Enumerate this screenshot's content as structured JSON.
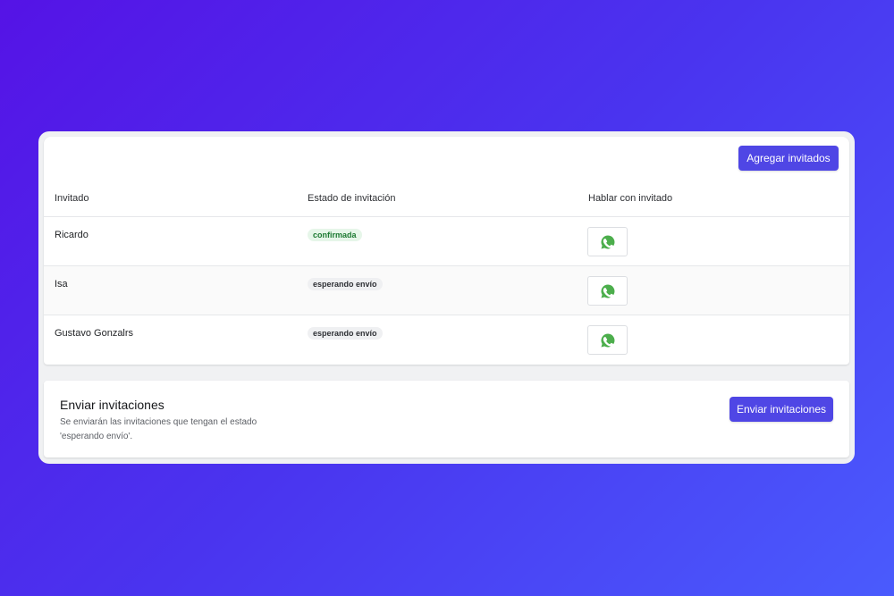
{
  "toolbar": {
    "add_guests_label": "Agregar invitados"
  },
  "table": {
    "columns": [
      "Invitado",
      "Estado de invitación",
      "Hablar con invitado"
    ],
    "rows": [
      {
        "name": "Ricardo",
        "status": "confirmada",
        "status_color": "#1d7a32",
        "action_icon": "whatsapp-icon"
      },
      {
        "name": "Isa",
        "status": "esperando envío",
        "status_color": "#2f3136",
        "action_icon": "whatsapp-icon"
      },
      {
        "name": "Gustavo Gonzalrs",
        "status": "esperando envío",
        "status_color": "#2f3136",
        "action_icon": "whatsapp-icon"
      }
    ]
  },
  "send_section": {
    "title": "Enviar invitaciones",
    "description": "Se enviarán las invitaciones que tengan el estado 'esperando envío'.",
    "button_label": "Enviar invitaciones"
  },
  "colors": {
    "accent": "#4f46e5",
    "whatsapp": "#4cae4c"
  }
}
